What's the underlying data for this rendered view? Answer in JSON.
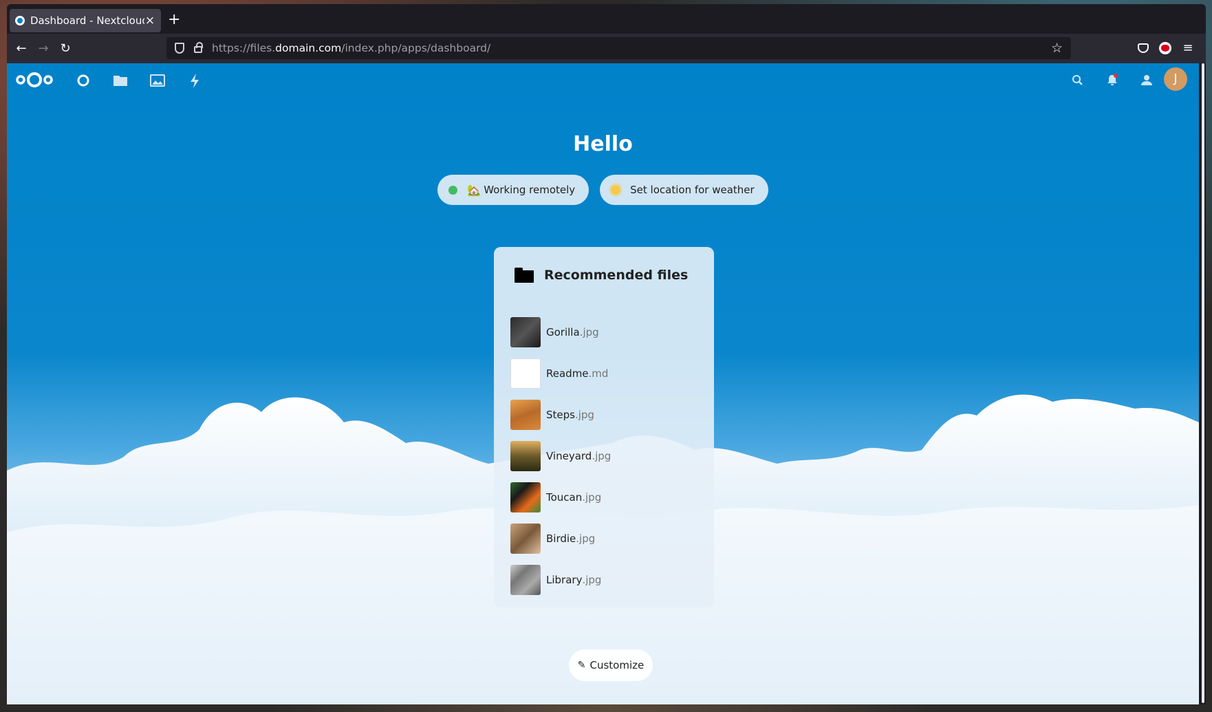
{
  "browser": {
    "tab_title": "Dashboard - Nextcloud",
    "tab_close": "×",
    "new_tab": "+",
    "url_prefix": "https://files.",
    "url_host": "domain.com",
    "url_path": "/index.php/apps/dashboard/",
    "back_glyph": "←",
    "forward_glyph": "→",
    "reload_glyph": "↻",
    "star_glyph": "☆",
    "menu_glyph": "≡"
  },
  "nextcloud": {
    "apps": [
      {
        "icon": "dashboard-icon"
      },
      {
        "icon": "files-icon"
      },
      {
        "icon": "photos-icon"
      },
      {
        "icon": "activity-icon"
      }
    ],
    "avatar_initial": "J",
    "greeting": "Hello",
    "status": {
      "emoji": "🏡",
      "label": "Working remotely",
      "status_color": "#46ba61"
    },
    "weather": {
      "label": "Set location for weather"
    },
    "panel": {
      "title": "Recommended files",
      "files": [
        {
          "name": "Gorilla",
          "ext": ".jpg",
          "thumb": "linear-gradient(135deg,#2a2a2a,#555,#1a1a1a)"
        },
        {
          "name": "Readme",
          "ext": ".md",
          "thumb": "#ffffff"
        },
        {
          "name": "Steps",
          "ext": ".jpg",
          "thumb": "linear-gradient(160deg,#e8a14f,#b86a2a,#d98a3a)"
        },
        {
          "name": "Vineyard",
          "ext": ".jpg",
          "thumb": "linear-gradient(180deg,#e0b060,#6b5a2a,#2a2a12)"
        },
        {
          "name": "Toucan",
          "ext": ".jpg",
          "thumb": "linear-gradient(135deg,#2f6a2a,#1a1a1a,#e86a1a,#3a8a3a)"
        },
        {
          "name": "Birdie",
          "ext": ".jpg",
          "thumb": "linear-gradient(135deg,#c9a27a,#7a5a3a,#e0c0a0)"
        },
        {
          "name": "Library",
          "ext": ".jpg",
          "thumb": "linear-gradient(135deg,#cfcfcf,#777,#aaa,#555)"
        }
      ]
    },
    "customize_label": "Customize",
    "accent": "#0082c9"
  }
}
